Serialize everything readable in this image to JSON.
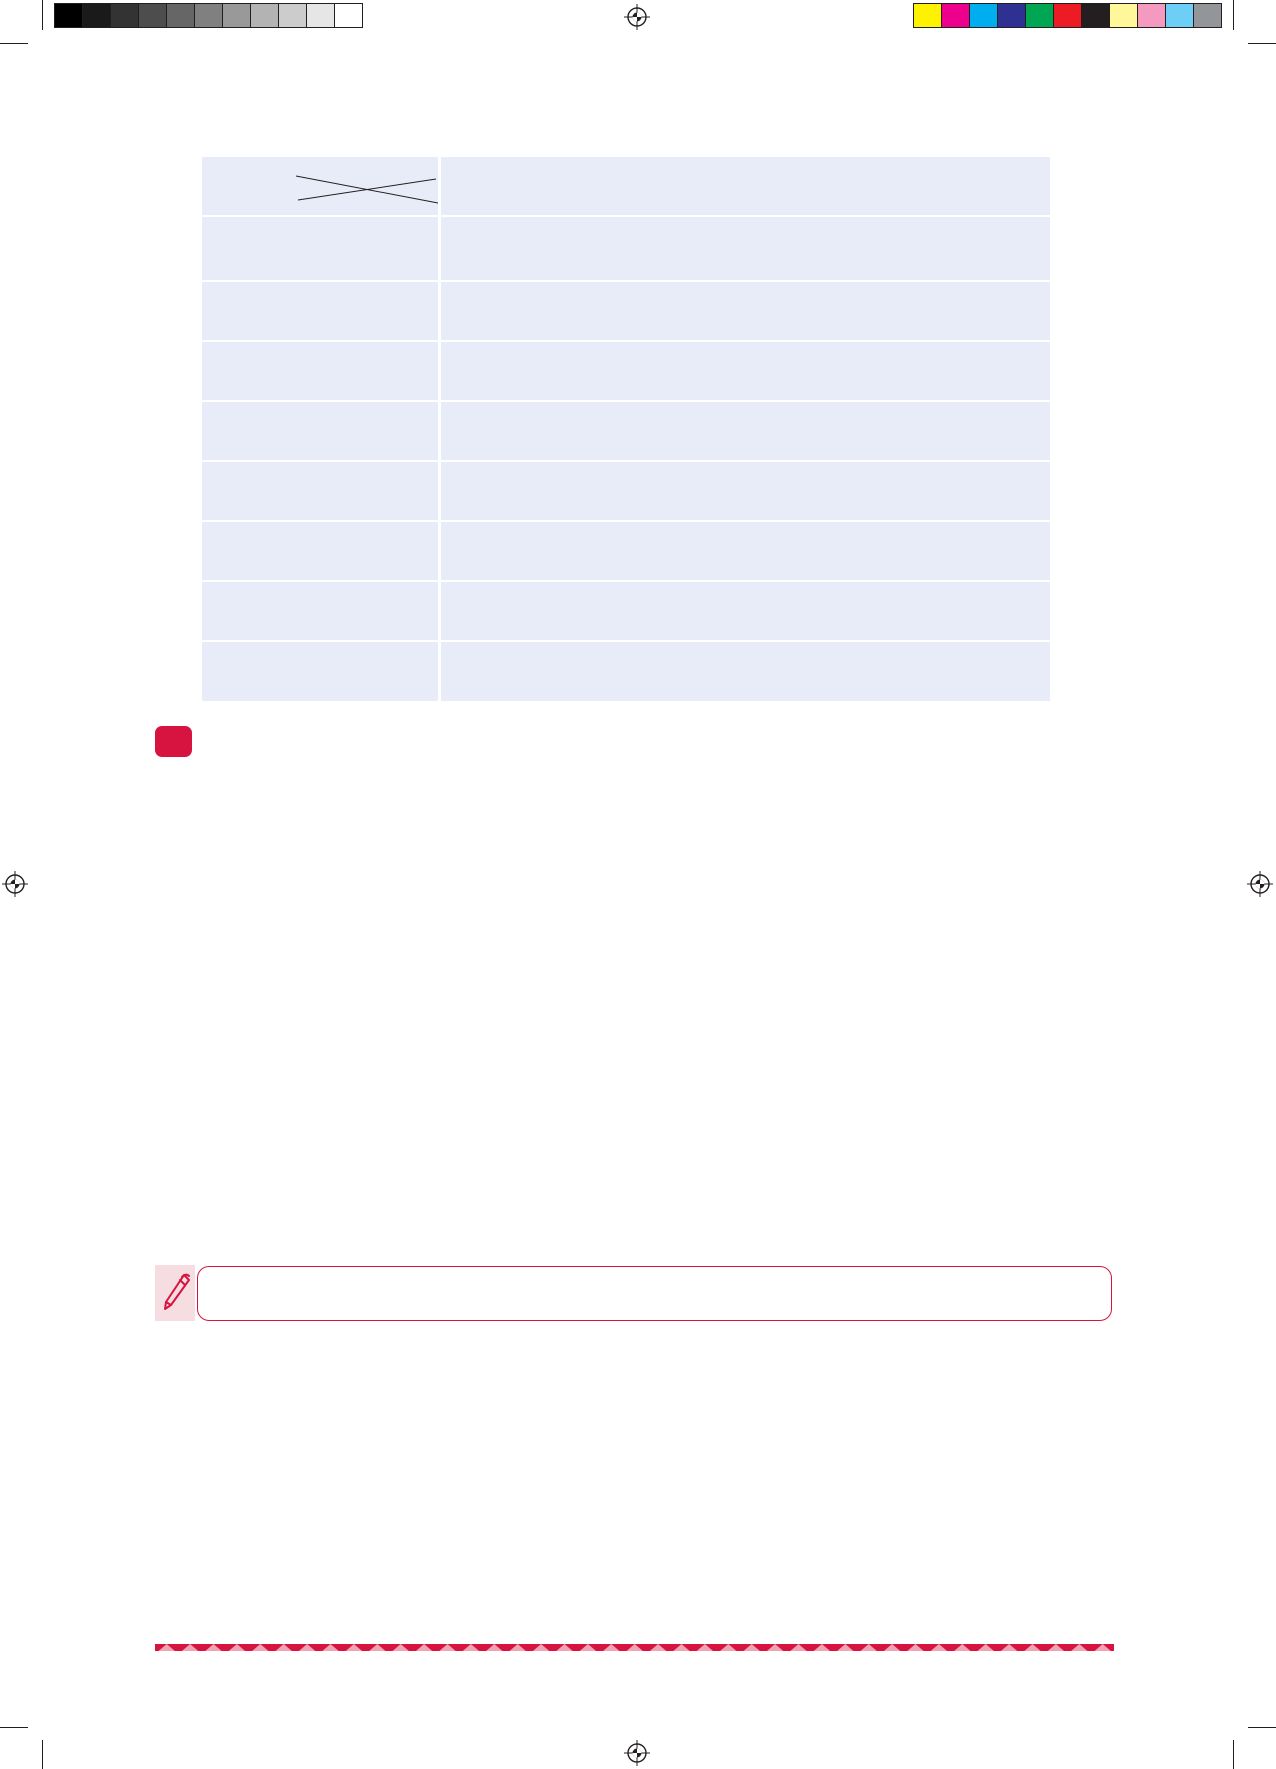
{
  "color_bar": {
    "grays": [
      "#000000",
      "#1a1a1a",
      "#333333",
      "#4d4d4d",
      "#666666",
      "#808080",
      "#999999",
      "#b3b3b3",
      "#cccccc",
      "#e6e6e6",
      "#ffffff"
    ],
    "colors": [
      "#fff200",
      "#ec008c",
      "#00aeef",
      "#2e3192",
      "#00a651",
      "#ed1c24",
      "#231f20",
      "#fff799",
      "#f49ac1",
      "#6dcff6",
      "#939598"
    ]
  },
  "table": {
    "rows": [
      {
        "label": "",
        "value": ""
      },
      {
        "label": "",
        "value": ""
      },
      {
        "label": "",
        "value": ""
      },
      {
        "label": "",
        "value": ""
      },
      {
        "label": "",
        "value": ""
      },
      {
        "label": "",
        "value": ""
      },
      {
        "label": "",
        "value": ""
      },
      {
        "label": "",
        "value": ""
      },
      {
        "label": "",
        "value": ""
      }
    ],
    "fill_color": "#e8ecf8"
  },
  "accent_color": "#d7143f",
  "section_badge": {
    "text": ""
  },
  "note": {
    "icon": "pen-icon",
    "text": ""
  }
}
